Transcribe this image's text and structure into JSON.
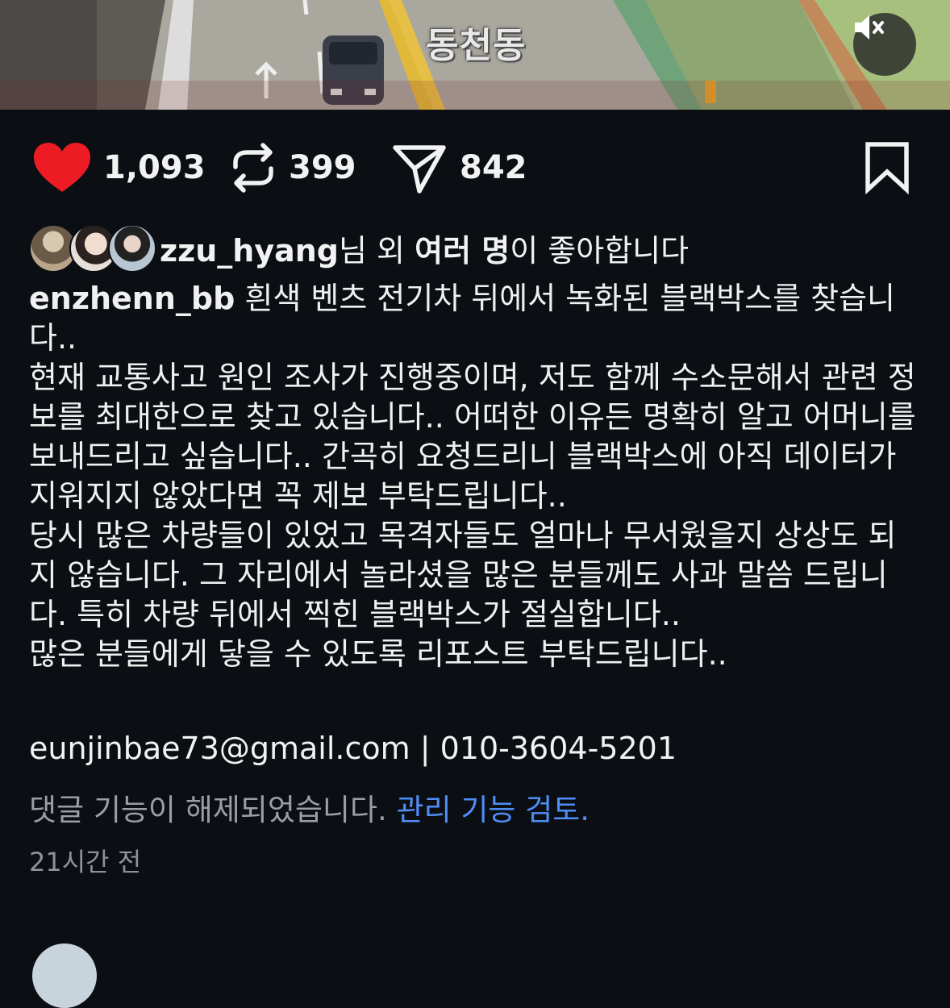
{
  "video": {
    "overlay_text": "동천동",
    "mute_icon": "speaker-muted-icon"
  },
  "actions": {
    "like_count": "1,093",
    "repost_count": "399",
    "share_count": "842",
    "like_color": "#ed1c24"
  },
  "likes": {
    "user": "zzu_hyang",
    "mid": "님 외 ",
    "bold": "여러 명",
    "tail": "이 좋아합니다"
  },
  "caption": {
    "username": "enzhenn_bb",
    "first": "흰색 벤츠 전기차 뒤에서 녹화된 블랙박스를 찾습니다..",
    "p2": "현재 교통사고 원인 조사가 진행중이며, 저도 함께 수소문해서 관련 정보를 최대한으로 찾고 있습니다.. 어떠한 이유든 명확히 알고 어머니를 보내드리고 싶습니다.. 간곡히 요청드리니 블랙박스에 아직 데이터가 지워지지 않았다면 꼭 제보 부탁드립니다..",
    "p3": "당시 많은 차량들이 있었고 목격자들도 얼마나 무서웠을지 상상도 되지 않습니다. 그 자리에서 놀라셨을 많은 분들께도 사과 말씀 드립니다. 특히 차량 뒤에서 찍힌 블랙박스가 절실합니다..",
    "p4": "많은 분들에게 닿을 수 있도록 리포스트 부탁드립니다.."
  },
  "contact": "eunjinbae73@gmail.com | 010-3604-5201",
  "comments": {
    "disabled": "댓글 기능이 해제되었습니다.",
    "link": "관리 기능 검토."
  },
  "timestamp": "21시간 전",
  "accent_link_color": "#4f8ef7"
}
